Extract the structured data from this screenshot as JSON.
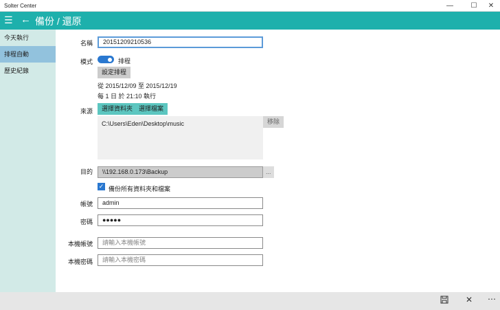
{
  "window": {
    "title": "Solter Center",
    "minimize": "—",
    "maximize": "☐",
    "close": "✕"
  },
  "header": {
    "title": "備份 / 還原"
  },
  "sidebar": {
    "items": [
      {
        "label": "今天執行"
      },
      {
        "label": "排程自動"
      },
      {
        "label": "歷史紀錄"
      }
    ]
  },
  "form": {
    "name_label": "名稱",
    "name_value": "20151209210536",
    "mode_label": "模式",
    "mode_toggle_label": "排程",
    "mode_on": true,
    "set_schedule": "設定排程",
    "range_text": "從  2015/12/09  至  2015/12/19",
    "repeat_text": "每 1 日 於  21:10  執行",
    "source_label": "來源",
    "choose_folder": "選擇資料夾",
    "choose_file": "選擇檔案",
    "source_items": [
      "C:\\Users\\Eden\\Desktop\\music"
    ],
    "remove": "移除",
    "dest_label": "目的",
    "dest_value": "\\\\192.168.0.173\\Backup",
    "browse": "...",
    "backup_all_label": "備份所有資料夾和檔案",
    "backup_all_checked": true,
    "account_label": "帳號",
    "account_value": "admin",
    "password_label": "密碼",
    "password_value": "●●●●●",
    "local_account_label": "本機帳號",
    "local_account_placeholder": "請輸入本機帳號",
    "local_password_label": "本機密碼",
    "local_password_placeholder": "請輸入本機密碼"
  },
  "colors": {
    "accent": "#1eb0ac",
    "toggle": "#2a78d0",
    "sidebar": "#d2eae7",
    "selected": "#92c2dd"
  }
}
